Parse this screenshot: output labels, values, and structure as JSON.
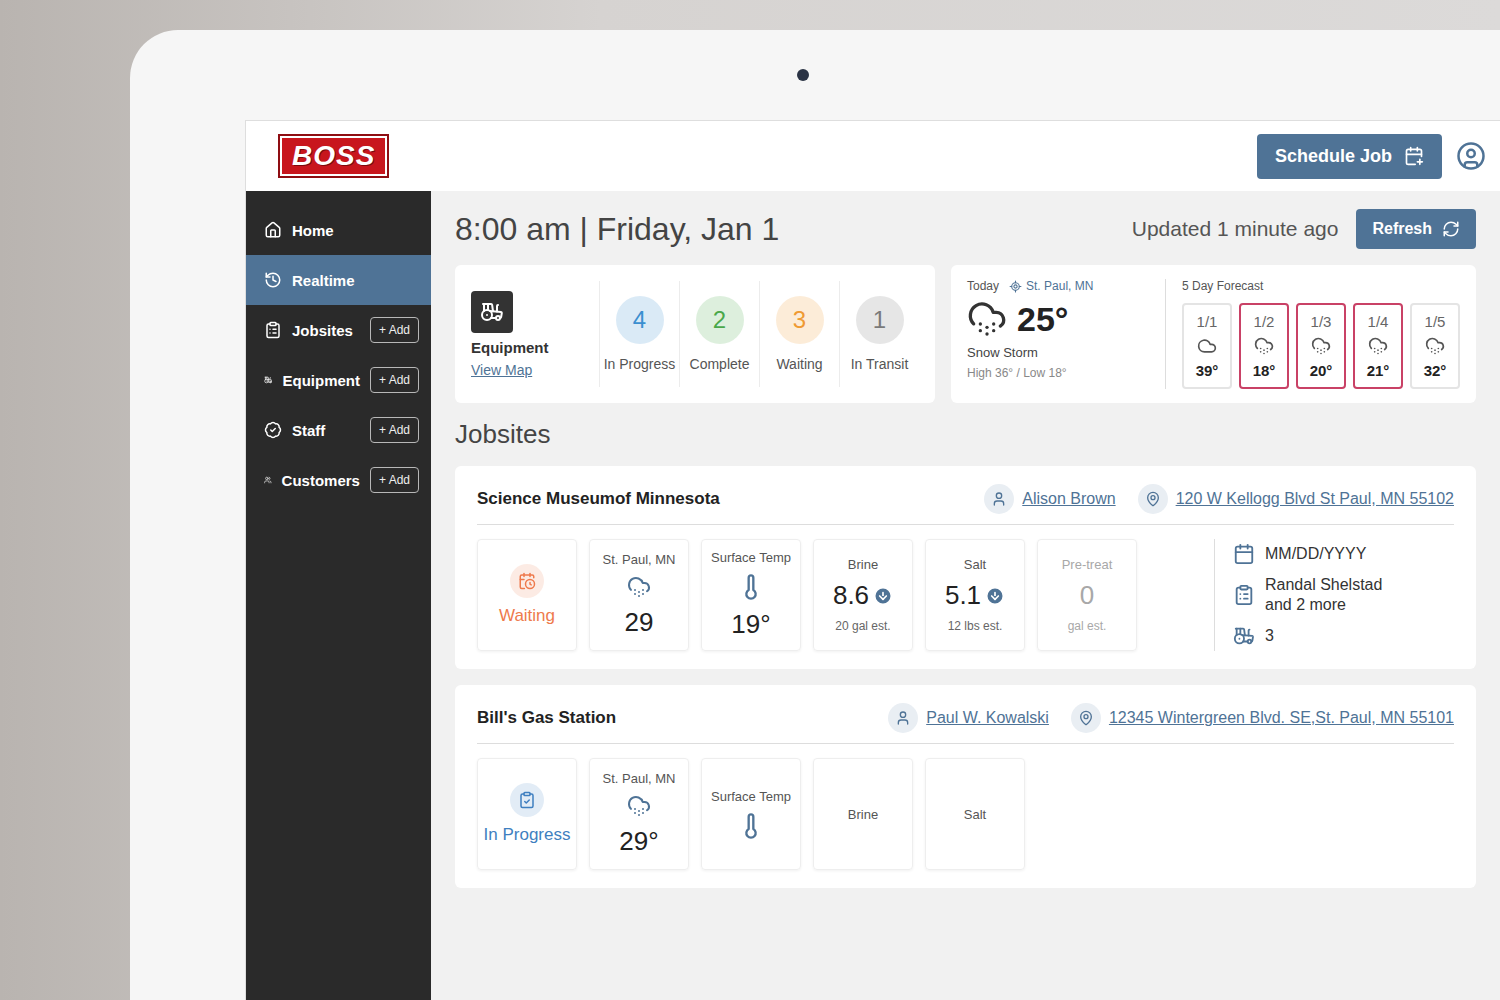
{
  "logo": "BOSS",
  "header": {
    "schedule_button": "Schedule Job"
  },
  "sidebar": {
    "items": [
      {
        "label": "Home",
        "selected": false,
        "icon": "home"
      },
      {
        "label": "Realtime",
        "selected": true,
        "icon": "realtime"
      },
      {
        "label": "Jobsites",
        "selected": false,
        "icon": "jobsites",
        "add": "+ Add"
      },
      {
        "label": "Equipment",
        "selected": false,
        "icon": "equipment",
        "add": "+ Add"
      },
      {
        "label": "Staff",
        "selected": false,
        "icon": "staff",
        "add": "+ Add"
      },
      {
        "label": "Customers",
        "selected": false,
        "icon": "customers",
        "add": "+ Add"
      }
    ]
  },
  "datetime": "8:00 am | Friday, Jan 1",
  "updated": "Updated 1 minute ago",
  "refresh_button": "Refresh",
  "equipment": {
    "label": "Equipment",
    "link": "View Map"
  },
  "stats": [
    {
      "count": "4",
      "label": "In Progress",
      "color": "#3b8fd0"
    },
    {
      "count": "2",
      "label": "Complete",
      "color": "#4aa84a"
    },
    {
      "count": "3",
      "label": "Waiting",
      "color": "#ef9a32"
    },
    {
      "count": "1",
      "label": "In Transit",
      "color": "#7a7a7a"
    }
  ],
  "weather": {
    "today": "Today",
    "location": "St. Paul, MN",
    "temp": "25°",
    "condition": "Snow Storm",
    "high_low": "High 36° / Low 18°",
    "forecast_title": "5 Day Forecast",
    "days": [
      {
        "date": "1/1",
        "temp": "39°",
        "alert": false,
        "kind": "cloud"
      },
      {
        "date": "1/2",
        "temp": "18°",
        "alert": true,
        "kind": "snow"
      },
      {
        "date": "1/3",
        "temp": "20°",
        "alert": true,
        "kind": "snow"
      },
      {
        "date": "1/4",
        "temp": "21°",
        "alert": true,
        "kind": "snow"
      },
      {
        "date": "1/5",
        "temp": "32°",
        "alert": false,
        "kind": "snow"
      }
    ]
  },
  "jobsites_title": "Jobsites",
  "jobsites": [
    {
      "name": "Science Museumof Minnesota",
      "contact": "Alison Brown",
      "address": "120 W Kellogg Blvd St Paul, MN 55102",
      "status": {
        "label": "Waiting",
        "color": "#ee7a4c",
        "kind": "waiting"
      },
      "metrics": [
        {
          "kind": "weather",
          "label": "St. Paul, MN",
          "value": "29"
        },
        {
          "kind": "temp",
          "label": "Surface Temp",
          "value": "19°"
        },
        {
          "kind": "amount",
          "label": "Brine",
          "value": "8.6",
          "note": "20 gal est.",
          "decreasing": true,
          "disabled": false
        },
        {
          "kind": "amount",
          "label": "Salt",
          "value": "5.1",
          "note": "12 lbs est.",
          "decreasing": true,
          "disabled": false
        },
        {
          "kind": "amount",
          "label": "Pre-treat",
          "value": "0",
          "note": "gal est.",
          "decreasing": false,
          "disabled": true
        }
      ],
      "details": {
        "date": "MM/DD/YYYY",
        "staff": "Randal Shelstad",
        "staff_more": "and 2 more",
        "equipment_count": "3"
      }
    },
    {
      "name": "Bill's Gas Station",
      "contact": "Paul W. Kowalski",
      "address": "12345 Wintergreen Blvd. SE,St. Paul, MN 55101",
      "status": {
        "label": "In Progress",
        "color": "#3f7fc0",
        "kind": "progress"
      },
      "metrics": [
        {
          "kind": "weather",
          "label": "St. Paul, MN",
          "value": "29°"
        },
        {
          "kind": "temp",
          "label": "Surface Temp"
        },
        {
          "kind": "amount",
          "label": "Brine",
          "disabled": false
        },
        {
          "kind": "amount",
          "label": "Salt",
          "disabled": false
        }
      ]
    }
  ]
}
